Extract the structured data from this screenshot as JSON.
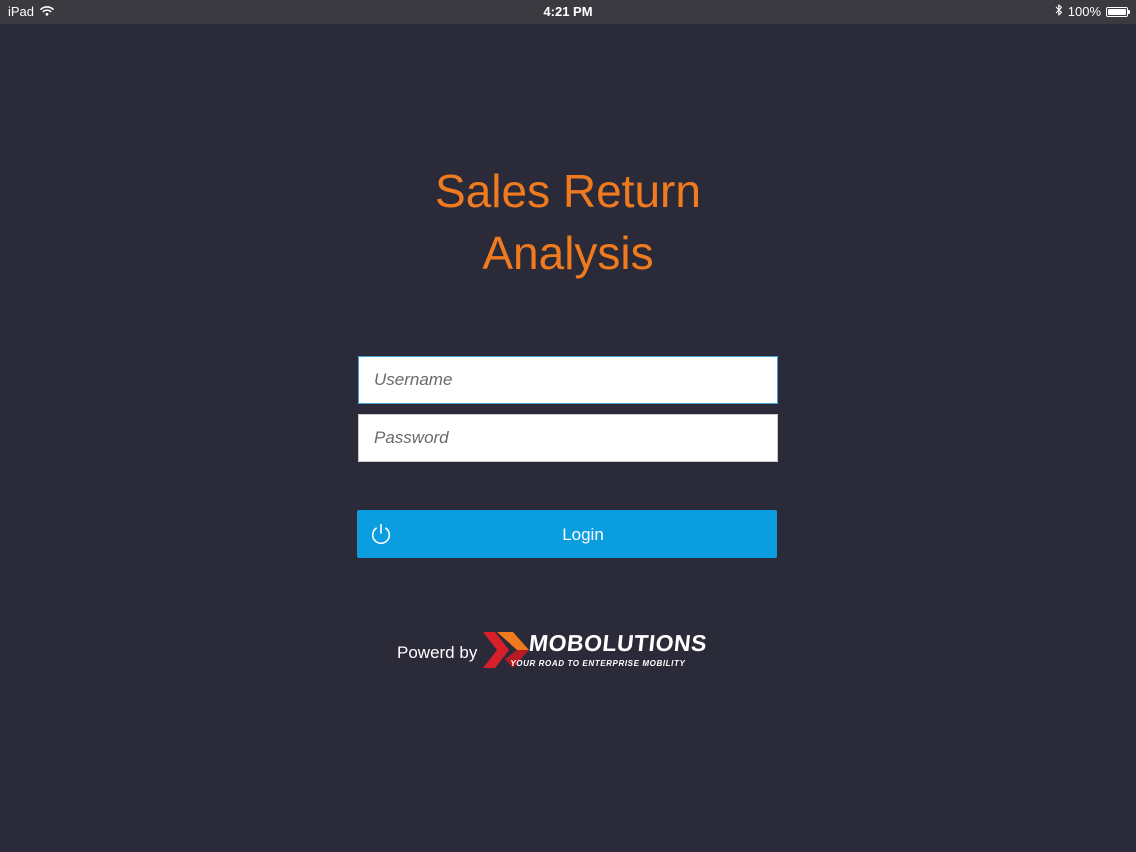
{
  "status_bar": {
    "device": "iPad",
    "time": "4:21 PM",
    "battery": "100%",
    "battery_level": 1.0,
    "icons": [
      "wifi-icon",
      "bluetooth-icon",
      "battery-icon"
    ]
  },
  "login": {
    "title_line1": "Sales Return",
    "title_line2": "Analysis",
    "username_placeholder": "Username",
    "username_value": "",
    "password_placeholder": "Password",
    "password_value": "",
    "login_label": "Login",
    "login_icon": "power-icon"
  },
  "footer": {
    "powered_label": "Powerd by",
    "brand_name": "MOBOLUTIONS",
    "brand_tagline": "YOUR ROAD TO ENTERPRISE MOBILITY"
  },
  "colors": {
    "background": "#2b2a39",
    "title": "#f07a1e",
    "button": "#0a9ee0",
    "logo_red": "#d8202a",
    "logo_orange": "#f07a1e"
  }
}
